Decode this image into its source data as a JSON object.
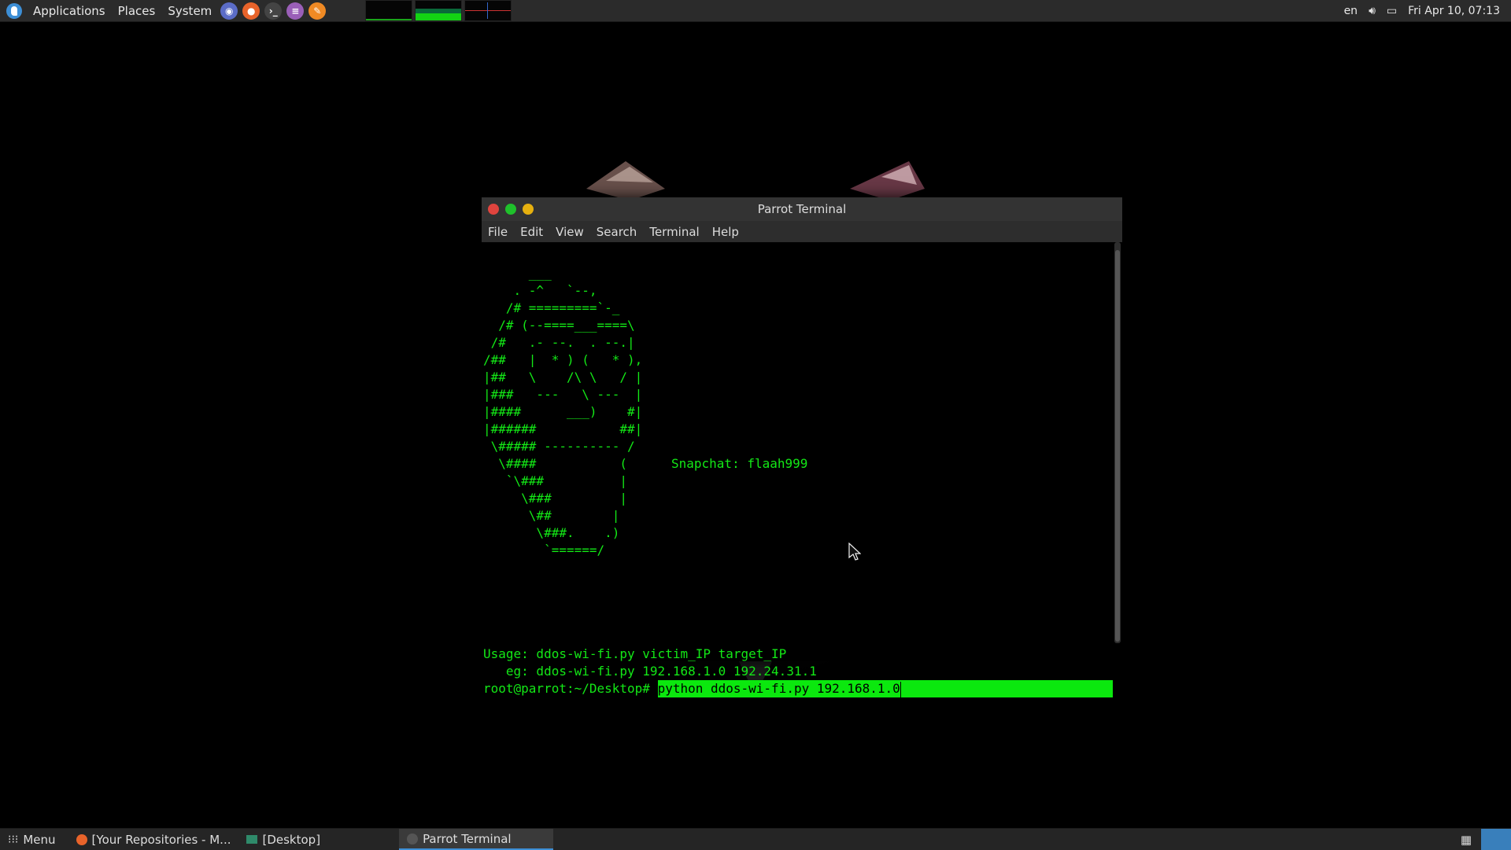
{
  "top_panel": {
    "menus": [
      "Applications",
      "Places",
      "System"
    ],
    "launchers": [
      {
        "icon": "screenshot-icon",
        "color": "#5b6cc7"
      },
      {
        "icon": "firefox-icon",
        "color": "#e8632a"
      },
      {
        "icon": "terminal-icon",
        "color": "#444444"
      },
      {
        "icon": "text-editor-icon",
        "color": "#9a5fb8"
      },
      {
        "icon": "pen-tool-icon",
        "color": "#f08a24"
      }
    ],
    "monitors": [
      {
        "name": "cpu-monitor",
        "level": 0.1
      },
      {
        "name": "memory-monitor",
        "level": 0.35
      },
      {
        "name": "network-monitor",
        "level": 0.2
      }
    ],
    "keyboard_layout": "en",
    "clock": "Fri Apr 10, 07:13"
  },
  "terminal": {
    "title": "Parrot Terminal",
    "menu": [
      "File",
      "Edit",
      "View",
      "Search",
      "Terminal",
      "Help"
    ],
    "ascii_art": "      ___\n    . -^   `--,\n   /# =========`-_\n  /# (--====___====\\\n /#   .- --.  . --.|\n/##   |  * ) (   * ),\n|##   \\    /\\ \\   / |\n|###   ---   \\ ---  |\n|####      ___)    #|\n|######           ##|\n \\##### ---------- /\n  \\####           (\n   `\\###          |\n     \\###         |\n      \\##        |\n       \\###.    .)\n        `======/",
    "snapchat": "Snapchat: flaah999",
    "usage": "Usage: ddos-wi-fi.py victim_IP target_IP",
    "example": "   eg: ddos-wi-fi.py 192.168.1.0 192.24.31.1",
    "prompt": "root@parrot:~/Desktop# ",
    "command": "python ddos-wi-fi.py 192.168.1.0",
    "text_color": "#13e816"
  },
  "taskbar": {
    "menu_label": "Menu",
    "items": [
      {
        "label": "[Your Repositories - M...",
        "icon": "firefox-icon"
      },
      {
        "label": "[Desktop]",
        "icon": "folder-icon"
      },
      {
        "label": "Parrot Terminal",
        "icon": "terminal-icon",
        "active": true
      }
    ]
  }
}
